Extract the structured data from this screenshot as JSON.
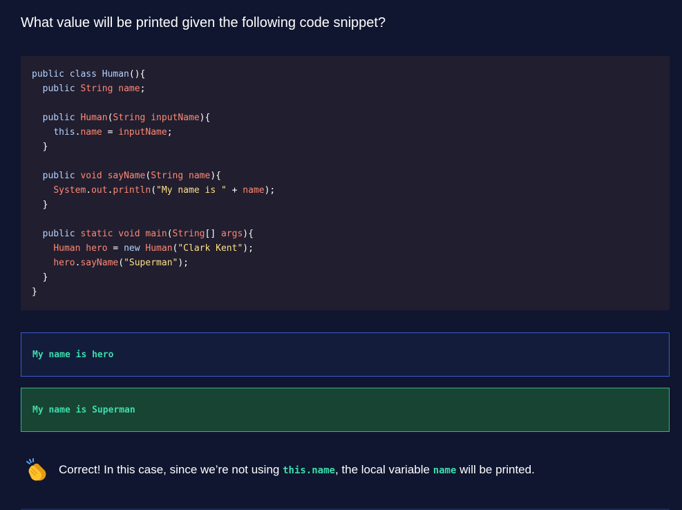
{
  "question": {
    "text": "What value will be printed given the following code snippet?"
  },
  "code": {
    "lines": [
      [
        [
          "kw",
          "public class "
        ],
        [
          "kw",
          "Human"
        ],
        [
          "pl",
          "(){"
        ]
      ],
      [
        [
          "pl",
          "  "
        ],
        [
          "kw",
          "public "
        ],
        [
          "ty",
          "String "
        ],
        [
          "id",
          "name"
        ],
        [
          "pl",
          ";"
        ]
      ],
      [],
      [
        [
          "pl",
          "  "
        ],
        [
          "kw",
          "public "
        ],
        [
          "id",
          "Human"
        ],
        [
          "pl",
          "("
        ],
        [
          "ty",
          "String "
        ],
        [
          "id",
          "inputName"
        ],
        [
          "pl",
          "){"
        ]
      ],
      [
        [
          "pl",
          "    "
        ],
        [
          "kw",
          "this"
        ],
        [
          "pl",
          "."
        ],
        [
          "id",
          "name"
        ],
        [
          "pl",
          " = "
        ],
        [
          "id",
          "inputName"
        ],
        [
          "pl",
          ";"
        ]
      ],
      [
        [
          "pl",
          "  }"
        ]
      ],
      [],
      [
        [
          "pl",
          "  "
        ],
        [
          "kw",
          "public "
        ],
        [
          "ty",
          "void "
        ],
        [
          "fn",
          "sayName"
        ],
        [
          "pl",
          "("
        ],
        [
          "ty",
          "String "
        ],
        [
          "id",
          "name"
        ],
        [
          "pl",
          "){"
        ]
      ],
      [
        [
          "pl",
          "    "
        ],
        [
          "id",
          "System"
        ],
        [
          "pl",
          "."
        ],
        [
          "id",
          "out"
        ],
        [
          "pl",
          "."
        ],
        [
          "fn",
          "println"
        ],
        [
          "pl",
          "("
        ],
        [
          "st",
          "\"My name is \""
        ],
        [
          "pl",
          " + "
        ],
        [
          "id",
          "name"
        ],
        [
          "pl",
          ");"
        ]
      ],
      [
        [
          "pl",
          "  }"
        ]
      ],
      [],
      [
        [
          "pl",
          "  "
        ],
        [
          "kw",
          "public "
        ],
        [
          "ty",
          "static "
        ],
        [
          "ty",
          "void "
        ],
        [
          "fn",
          "main"
        ],
        [
          "pl",
          "("
        ],
        [
          "ty",
          "String"
        ],
        [
          "pl",
          "[] "
        ],
        [
          "id",
          "args"
        ],
        [
          "pl",
          "){"
        ]
      ],
      [
        [
          "pl",
          "    "
        ],
        [
          "ty",
          "Human "
        ],
        [
          "id",
          "hero"
        ],
        [
          "pl",
          " = "
        ],
        [
          "kw",
          "new "
        ],
        [
          "id",
          "Human"
        ],
        [
          "pl",
          "("
        ],
        [
          "st",
          "\"Clark Kent\""
        ],
        [
          "pl",
          ");"
        ]
      ],
      [
        [
          "pl",
          "    "
        ],
        [
          "id",
          "hero"
        ],
        [
          "pl",
          "."
        ],
        [
          "fn",
          "sayName"
        ],
        [
          "pl",
          "("
        ],
        [
          "st",
          "\"Superman\""
        ],
        [
          "pl",
          ");"
        ]
      ],
      [
        [
          "pl",
          "  }"
        ]
      ],
      [
        [
          "pl",
          "}"
        ]
      ]
    ]
  },
  "options": [
    {
      "label": "My name is hero",
      "state": "unselected"
    },
    {
      "label": "My name is Superman",
      "state": "correct"
    }
  ],
  "feedback": {
    "icon": "clapping-hands-icon",
    "prefix": "Correct! In this case, since we’re not using ",
    "code1": "this.name",
    "middle": ", the local variable ",
    "code2": "name",
    "suffix": " will be printed."
  }
}
